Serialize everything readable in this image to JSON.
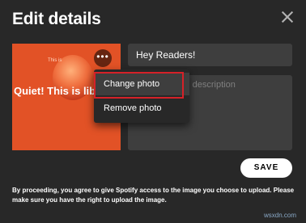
{
  "dialog": {
    "title": "Edit details",
    "close_icon": "close-icon"
  },
  "cover": {
    "small_text": "This is",
    "text": "Quiet! This is library!",
    "more_icon": "more-options-icon",
    "more_glyph": "•••"
  },
  "context_menu": {
    "items": [
      {
        "label": "Change photo"
      },
      {
        "label": "Remove photo"
      }
    ]
  },
  "form": {
    "name_value": "Hey Readers!",
    "description_placeholder": "al description"
  },
  "actions": {
    "save_label": "SAVE"
  },
  "disclaimer": "By proceeding, you agree to give Spotify access to the image you choose to upload. Please make sure you have the right to upload the image.",
  "watermark": "wsxdn.com"
}
